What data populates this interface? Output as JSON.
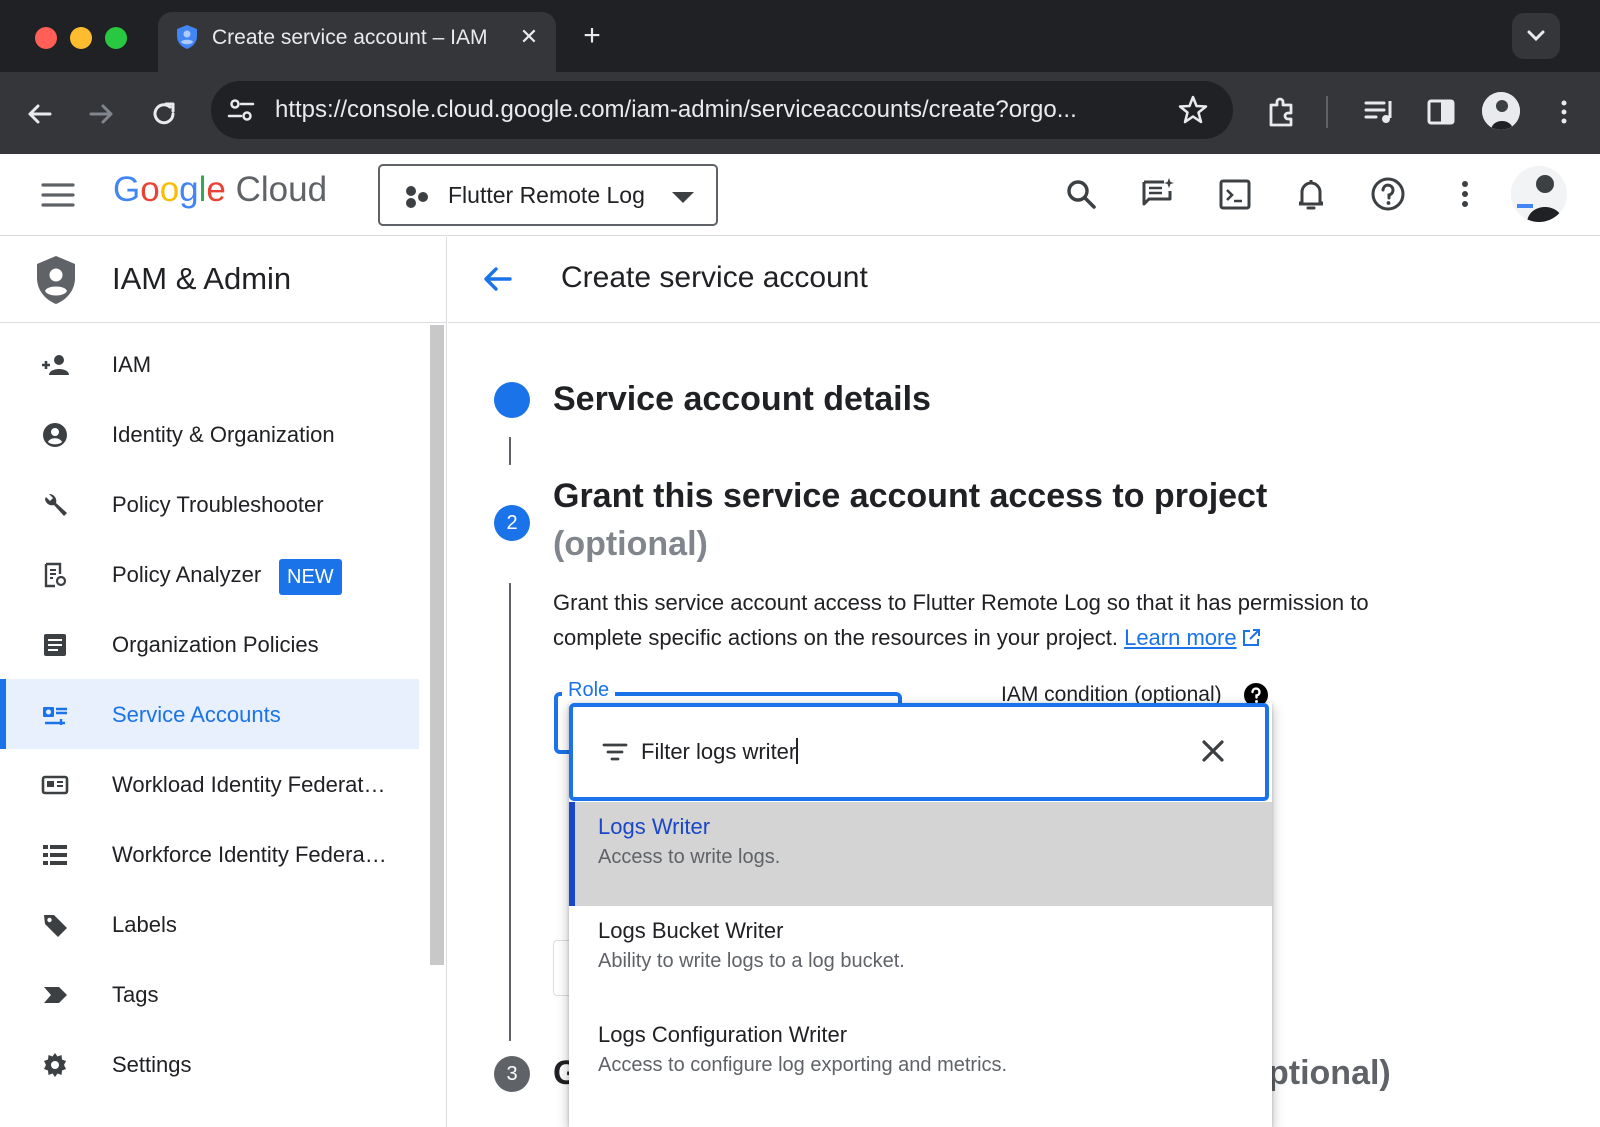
{
  "browser": {
    "tab_title": "Create service account – IAM",
    "tab_close": "✕",
    "new_tab": "+",
    "url": "https://console.cloud.google.com/iam-admin/serviceaccounts/create?orgo..."
  },
  "header": {
    "logo": {
      "g1": "G",
      "o1": "o",
      "o2": "o",
      "g2": "g",
      "l": "l",
      "e": "e",
      "cloud": "Cloud"
    },
    "project_name": "Flutter Remote Log",
    "icons": [
      "search-icon",
      "feedback-icon",
      "cloud-shell-icon",
      "notifications-icon",
      "help-icon",
      "more-vert-icon"
    ]
  },
  "sidebar": {
    "title": "IAM & Admin",
    "items": [
      {
        "label": "IAM",
        "icon": "person-add-icon"
      },
      {
        "label": "Identity & Organization",
        "icon": "account-circle-icon"
      },
      {
        "label": "Policy Troubleshooter",
        "icon": "wrench-icon"
      },
      {
        "label": "Policy Analyzer",
        "icon": "policy-analyzer-icon",
        "badge": "NEW"
      },
      {
        "label": "Organization Policies",
        "icon": "document-icon"
      },
      {
        "label": "Service Accounts",
        "icon": "service-account-icon",
        "active": true
      },
      {
        "label": "Workload Identity Federat…",
        "icon": "id-card-icon"
      },
      {
        "label": "Workforce Identity Federa…",
        "icon": "list-icon"
      },
      {
        "label": "Labels",
        "icon": "label-icon"
      },
      {
        "label": "Tags",
        "icon": "tag-icon"
      },
      {
        "label": "Settings",
        "icon": "gear-icon"
      }
    ]
  },
  "main": {
    "page_title": "Create service account",
    "step1": {
      "title": "Service account details"
    },
    "step2": {
      "number": "2",
      "title": "Grant this service account access to project",
      "optional": "(optional)",
      "description": "Grant this service account access to Flutter Remote Log so that it has permission to complete specific actions on the resources in your project.",
      "learn_more": "Learn more"
    },
    "role_label": "Role",
    "iam_condition": "IAM condition (optional)",
    "step3": {
      "number": "3",
      "title_start": "G",
      "title_end": "ptional)"
    }
  },
  "dropdown": {
    "filter_value": "Filter logs writer",
    "options": [
      {
        "title": "Logs Writer",
        "description": "Access to write logs.",
        "selected": true
      },
      {
        "title": "Logs Bucket Writer",
        "description": "Ability to write logs to a log bucket.",
        "selected": false
      },
      {
        "title": "Logs Configuration Writer",
        "description": "Access to configure log exporting and metrics.",
        "selected": false
      }
    ]
  },
  "colors": {
    "accent": "#1a73e8",
    "selected_text": "#1a47c9",
    "selected_bg": "#d4d4d4",
    "chrome_dark": "#202124",
    "chrome_toolbar": "#35363a"
  }
}
